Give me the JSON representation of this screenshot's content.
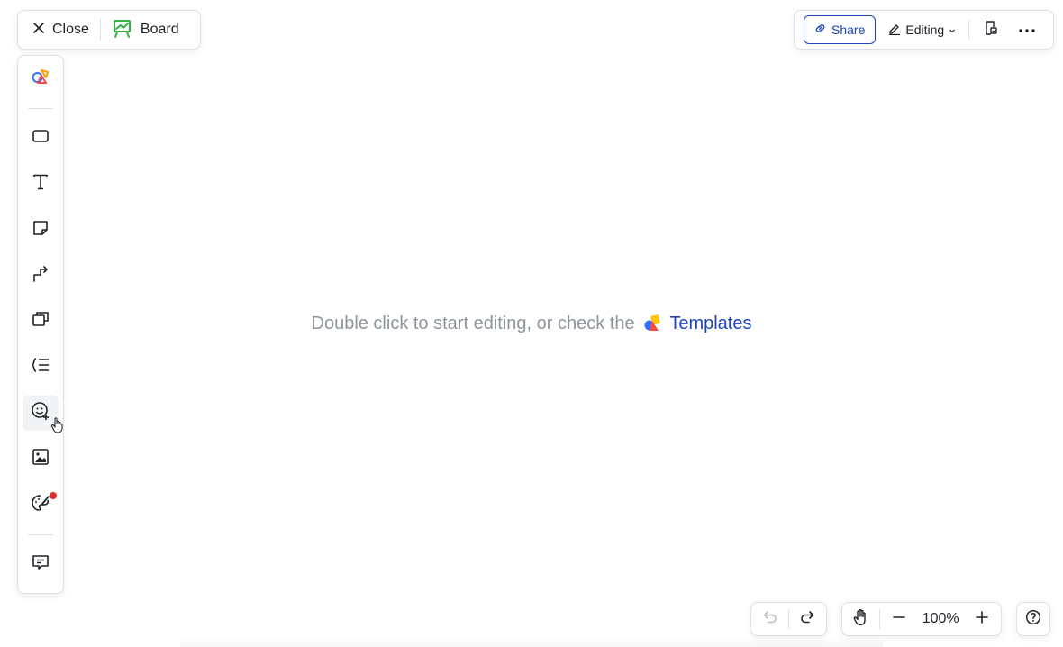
{
  "header": {
    "close_label": "Close",
    "board_label": "Board",
    "share_label": "Share",
    "edit_mode_label": "Editing"
  },
  "toolbar": {
    "items": [
      {
        "name": "shapes-library",
        "icon": "shapes-color-icon"
      },
      {
        "name": "rectangle",
        "icon": "rectangle-icon"
      },
      {
        "name": "text",
        "icon": "text-icon"
      },
      {
        "name": "sticky-note",
        "icon": "sticky-note-icon"
      },
      {
        "name": "connector",
        "icon": "connector-arrow-icon"
      },
      {
        "name": "frame",
        "icon": "frame-icon"
      },
      {
        "name": "mindmap",
        "icon": "mindmap-icon"
      },
      {
        "name": "sticker",
        "icon": "emoji-add-icon"
      },
      {
        "name": "image",
        "icon": "image-icon"
      },
      {
        "name": "brush",
        "icon": "palette-icon"
      },
      {
        "name": "comment",
        "icon": "comment-icon"
      }
    ]
  },
  "canvas": {
    "hint_text": "Double click to start editing, or check the",
    "templates_link": "Templates"
  },
  "bottom": {
    "zoom_level": "100%"
  },
  "colors": {
    "accent": "#1d45b8",
    "board_green": "#34b345",
    "notification_red": "#e02f2f"
  }
}
